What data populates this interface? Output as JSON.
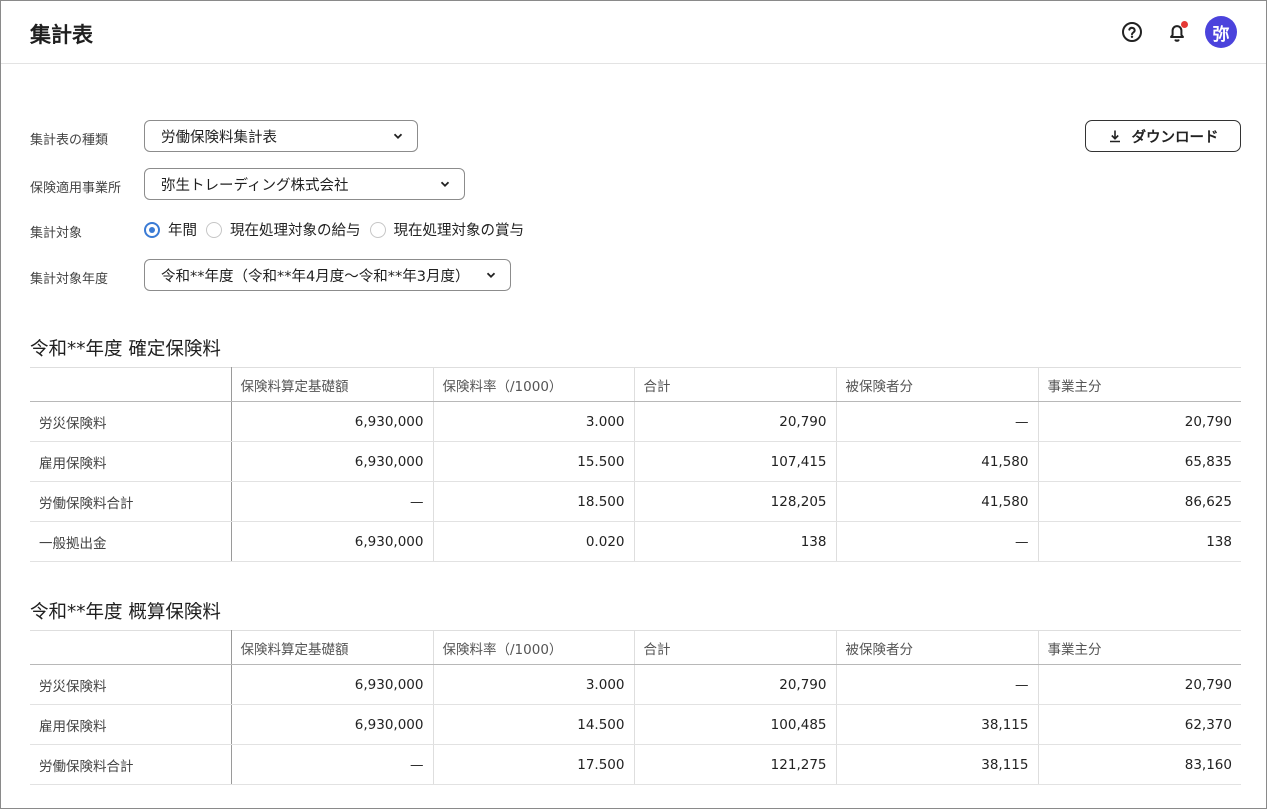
{
  "header": {
    "title": "集計表",
    "avatar_text": "弥"
  },
  "form": {
    "type_label": "集計表の種類",
    "type_value": "労働保険料集計表",
    "office_label": "保険適用事業所",
    "office_value": "弥生トレーディング株式会社",
    "target_label": "集計対象",
    "target_options": [
      "年間",
      "現在処理対象の給与",
      "現在処理対象の賞与"
    ],
    "target_selected": "年間",
    "year_label": "集計対象年度",
    "year_value": "令和**年度（令和**年4月度〜令和**年3月度）",
    "download_label": "ダウンロード"
  },
  "columns": [
    "",
    "保険料算定基礎額",
    "保険料率（/1000）",
    "合計",
    "被保険者分",
    "事業主分"
  ],
  "confirmed": {
    "title": "令和**年度 確定保険料",
    "rows": [
      [
        "労災保険料",
        "6,930,000",
        "3.000",
        "20,790",
        "—",
        "20,790"
      ],
      [
        "雇用保険料",
        "6,930,000",
        "15.500",
        "107,415",
        "41,580",
        "65,835"
      ],
      [
        "労働保険料合計",
        "—",
        "18.500",
        "128,205",
        "41,580",
        "86,625"
      ],
      [
        "一般拠出金",
        "6,930,000",
        "0.020",
        "138",
        "—",
        "138"
      ]
    ]
  },
  "estimated": {
    "title": "令和**年度 概算保険料",
    "rows": [
      [
        "労災保険料",
        "6,930,000",
        "3.000",
        "20,790",
        "—",
        "20,790"
      ],
      [
        "雇用保険料",
        "6,930,000",
        "14.500",
        "100,485",
        "38,115",
        "62,370"
      ],
      [
        "労働保険料合計",
        "—",
        "17.500",
        "121,275",
        "38,115",
        "83,160"
      ]
    ]
  },
  "colors": {
    "accent": "#3a7bd5",
    "avatar": "#4b43dc",
    "notify": "#e53935"
  }
}
